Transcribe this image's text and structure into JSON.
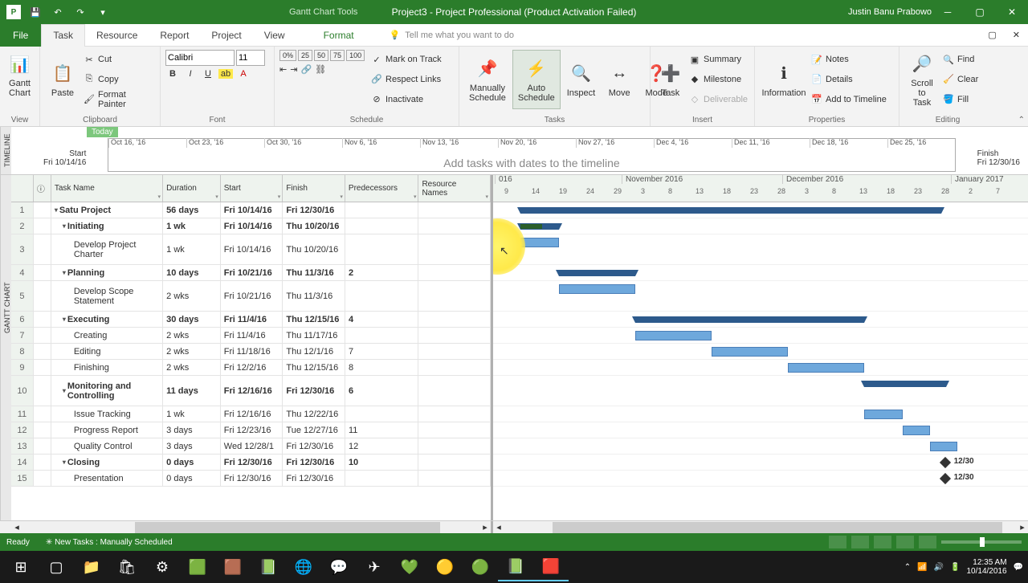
{
  "titlebar": {
    "tools_label": "Gantt Chart Tools",
    "title": "Project3 - Project Professional (Product Activation Failed)",
    "user": "Justin Banu Prabowo"
  },
  "tabs": {
    "file": "File",
    "task": "Task",
    "resource": "Resource",
    "report": "Report",
    "project": "Project",
    "view": "View",
    "format": "Format",
    "tellme": "Tell me what you want to do"
  },
  "ribbon": {
    "gantt": "Gantt\nChart",
    "view_label": "View",
    "paste": "Paste",
    "cut": "Cut",
    "copy": "Copy",
    "format_painter": "Format Painter",
    "clipboard": "Clipboard",
    "font_name": "Calibri",
    "font_size": "11",
    "font_label": "Font",
    "schedule_label": "Schedule",
    "mark_on_track": "Mark on Track",
    "respect_links": "Respect Links",
    "inactivate": "Inactivate",
    "manually": "Manually\nSchedule",
    "auto": "Auto\nSchedule",
    "inspect": "Inspect",
    "move": "Move",
    "mode": "Mode",
    "tasks_label": "Tasks",
    "task_btn": "Task",
    "summary": "Summary",
    "milestone": "Milestone",
    "deliverable": "Deliverable",
    "insert_label": "Insert",
    "information": "Information",
    "notes": "Notes",
    "details": "Details",
    "add_timeline": "Add to Timeline",
    "properties": "Properties",
    "scroll_task": "Scroll\nto Task",
    "find": "Find",
    "clear": "Clear",
    "fill": "Fill",
    "editing": "Editing"
  },
  "timeline": {
    "label": "TIMELINE",
    "today": "Today",
    "start_label": "Start",
    "start_date": "Fri 10/14/16",
    "finish_label": "Finish",
    "finish_date": "Fri 12/30/16",
    "ticks": [
      "Oct 16, '16",
      "Oct 23, '16",
      "Oct 30, '16",
      "Nov 6, '16",
      "Nov 13, '16",
      "Nov 20, '16",
      "Nov 27, '16",
      "Dec 4, '16",
      "Dec 11, '16",
      "Dec 18, '16",
      "Dec 25, '16"
    ],
    "placeholder": "Add tasks with dates to the timeline"
  },
  "grid": {
    "gantt_label": "GANTT CHART",
    "view_btn": "View",
    "headers": {
      "task": "Task Name",
      "dur": "Duration",
      "start": "Start",
      "finish": "Finish",
      "pred": "Predecessors",
      "res": "Resource\nNames"
    },
    "rows": [
      {
        "id": "1",
        "ind": 0,
        "sum": true,
        "name": "Satu Project",
        "dur": "56 days",
        "start": "Fri 10/14/16",
        "finish": "Fri 12/30/16",
        "pred": ""
      },
      {
        "id": "2",
        "ind": 1,
        "sum": true,
        "name": "Initiating",
        "dur": "1 wk",
        "start": "Fri 10/14/16",
        "finish": "Thu 10/20/16",
        "pred": ""
      },
      {
        "id": "3",
        "ind": 2,
        "sum": false,
        "name": "Develop Project Charter",
        "dur": "1 wk",
        "start": "Fri 10/14/16",
        "finish": "Thu 10/20/16",
        "pred": "",
        "tall": true
      },
      {
        "id": "4",
        "ind": 1,
        "sum": true,
        "name": "Planning",
        "dur": "10 days",
        "start": "Fri 10/21/16",
        "finish": "Thu 11/3/16",
        "pred": "2"
      },
      {
        "id": "5",
        "ind": 2,
        "sum": false,
        "name": "Develop Scope Statement",
        "dur": "2 wks",
        "start": "Fri 10/21/16",
        "finish": "Thu 11/3/16",
        "pred": "",
        "tall": true
      },
      {
        "id": "6",
        "ind": 1,
        "sum": true,
        "name": "Executing",
        "dur": "30 days",
        "start": "Fri 11/4/16",
        "finish": "Thu 12/15/16",
        "pred": "4"
      },
      {
        "id": "7",
        "ind": 2,
        "sum": false,
        "name": "Creating",
        "dur": "2 wks",
        "start": "Fri 11/4/16",
        "finish": "Thu 11/17/16",
        "pred": ""
      },
      {
        "id": "8",
        "ind": 2,
        "sum": false,
        "name": "Editing",
        "dur": "2 wks",
        "start": "Fri 11/18/16",
        "finish": "Thu 12/1/16",
        "pred": "7"
      },
      {
        "id": "9",
        "ind": 2,
        "sum": false,
        "name": "Finishing",
        "dur": "2 wks",
        "start": "Fri 12/2/16",
        "finish": "Thu 12/15/16",
        "pred": "8"
      },
      {
        "id": "10",
        "ind": 1,
        "sum": true,
        "name": "Monitoring and Controlling",
        "dur": "11 days",
        "start": "Fri 12/16/16",
        "finish": "Fri 12/30/16",
        "pred": "6",
        "tall": true
      },
      {
        "id": "11",
        "ind": 2,
        "sum": false,
        "name": "Issue Tracking",
        "dur": "1 wk",
        "start": "Fri 12/16/16",
        "finish": "Thu 12/22/16",
        "pred": ""
      },
      {
        "id": "12",
        "ind": 2,
        "sum": false,
        "name": "Progress Report",
        "dur": "3 days",
        "start": "Fri 12/23/16",
        "finish": "Tue 12/27/16",
        "pred": "11"
      },
      {
        "id": "13",
        "ind": 2,
        "sum": false,
        "name": "Quality Control",
        "dur": "3 days",
        "start": "Wed 12/28/1",
        "finish": "Fri 12/30/16",
        "pred": "12"
      },
      {
        "id": "14",
        "ind": 1,
        "sum": true,
        "name": "Closing",
        "dur": "0 days",
        "start": "Fri 12/30/16",
        "finish": "Fri 12/30/16",
        "pred": "10"
      },
      {
        "id": "15",
        "ind": 2,
        "sum": false,
        "name": "Presentation",
        "dur": "0 days",
        "start": "Fri 12/30/16",
        "finish": "Fri 12/30/16",
        "pred": ""
      }
    ]
  },
  "gantt": {
    "month_year_short": "016",
    "months": [
      "November 2016",
      "December 2016",
      "January 2017"
    ],
    "days": [
      "9",
      "14",
      "19",
      "24",
      "29",
      "3",
      "8",
      "13",
      "18",
      "23",
      "28",
      "3",
      "8",
      "13",
      "18",
      "23",
      "28",
      "2",
      "7"
    ],
    "mile_label": "12/30"
  },
  "status": {
    "ready": "Ready",
    "newtasks": "New Tasks : Manually Scheduled"
  },
  "tray": {
    "time": "12:35 AM",
    "date": "10/14/2016"
  }
}
